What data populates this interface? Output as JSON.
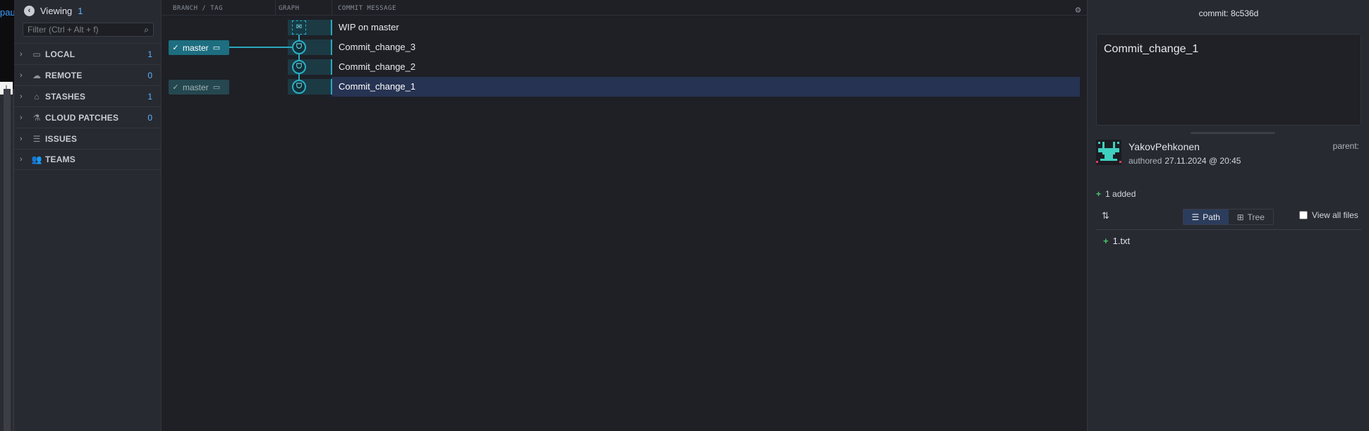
{
  "edge": {
    "partial_text": "рац",
    "download_icon": "download-icon"
  },
  "sidebar": {
    "viewing_label": "Viewing",
    "viewing_count": "1",
    "filter_placeholder": "Filter (Ctrl + Alt + f)",
    "sections": [
      {
        "label": "LOCAL",
        "count": "1",
        "icon": "laptop-icon"
      },
      {
        "label": "REMOTE",
        "count": "0",
        "icon": "cloud-icon"
      },
      {
        "label": "STASHES",
        "count": "1",
        "icon": "stash-icon"
      },
      {
        "label": "CLOUD PATCHES",
        "count": "0",
        "icon": "flask-icon"
      },
      {
        "label": "ISSUES",
        "count": "",
        "icon": "list-icon"
      },
      {
        "label": "TEAMS",
        "count": "",
        "icon": "people-icon"
      }
    ]
  },
  "graph": {
    "headers": {
      "branch": "BRANCH / TAG",
      "graph": "GRAPH",
      "message": "COMMIT MESSAGE"
    },
    "rows": [
      {
        "message": "WIP on master",
        "branch": ""
      },
      {
        "message": "Commit_change_3",
        "branch": "master"
      },
      {
        "message": "Commit_change_2",
        "branch": ""
      },
      {
        "message": "Commit_change_1",
        "branch": "master"
      }
    ]
  },
  "details": {
    "commit_label": "commit:",
    "commit_hash": "8c536d",
    "message": "Commit_change_1",
    "author": "YakovPehkonen",
    "authored_label": "authored",
    "authored_date": "27.11.2024 @ 20:45",
    "parent_label": "parent:",
    "added_summary": "1 added",
    "view_path": "Path",
    "view_tree": "Tree",
    "view_all_files": "View all files",
    "files": [
      "1.txt"
    ]
  }
}
